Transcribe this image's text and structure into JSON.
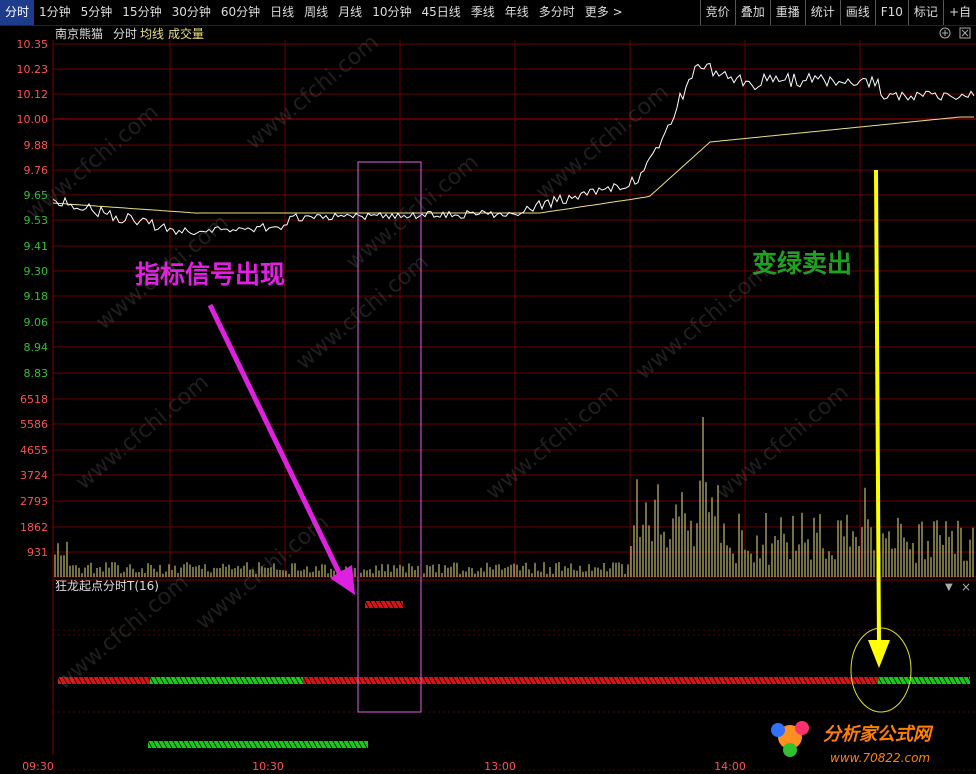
{
  "toolbar": {
    "tabs": [
      "分时",
      "1分钟",
      "5分钟",
      "15分钟",
      "30分钟",
      "60分钟",
      "日线",
      "周线",
      "月线",
      "10分钟",
      "45日线",
      "季线",
      "年线",
      "多分时",
      "更多 >"
    ],
    "right_buttons": [
      "竞价",
      "叠加",
      "重播",
      "统计",
      "画线",
      "F10",
      "标记",
      "+自"
    ]
  },
  "header": {
    "stock_name": "南京熊猫",
    "mode": "分时",
    "avg_label": "均线",
    "vol_label": "成交量"
  },
  "price_axis": [
    "10.35",
    "10.23",
    "10.12",
    "10.00",
    "9.88",
    "9.76",
    "9.65",
    "9.53",
    "9.41",
    "9.30",
    "9.18",
    "9.06",
    "8.94",
    "8.83"
  ],
  "volume_axis": [
    "6518",
    "5586",
    "4655",
    "3724",
    "2793",
    "1862",
    "931"
  ],
  "time_axis": [
    "09:30",
    "10:30",
    "13:00",
    "14:00"
  ],
  "indicator": {
    "title": "狂龙起点分时T(16)"
  },
  "annotations": {
    "signal_text": "指标信号出现",
    "sell_text": "变绿卖出"
  },
  "logo": {
    "text": "分析家公式网",
    "url": "www.70822.com"
  },
  "watermark": "www.cfchi.com",
  "colors": {
    "up": "#e01010",
    "down": "#10d010",
    "price_line": "#ffffff",
    "avg_line": "#e8e080",
    "grid": "#7a0000",
    "axis_up": "#ff5050",
    "axis_down": "#30c030",
    "annotation_magenta": "#e020e0",
    "annotation_yellow": "#ffff00"
  }
}
